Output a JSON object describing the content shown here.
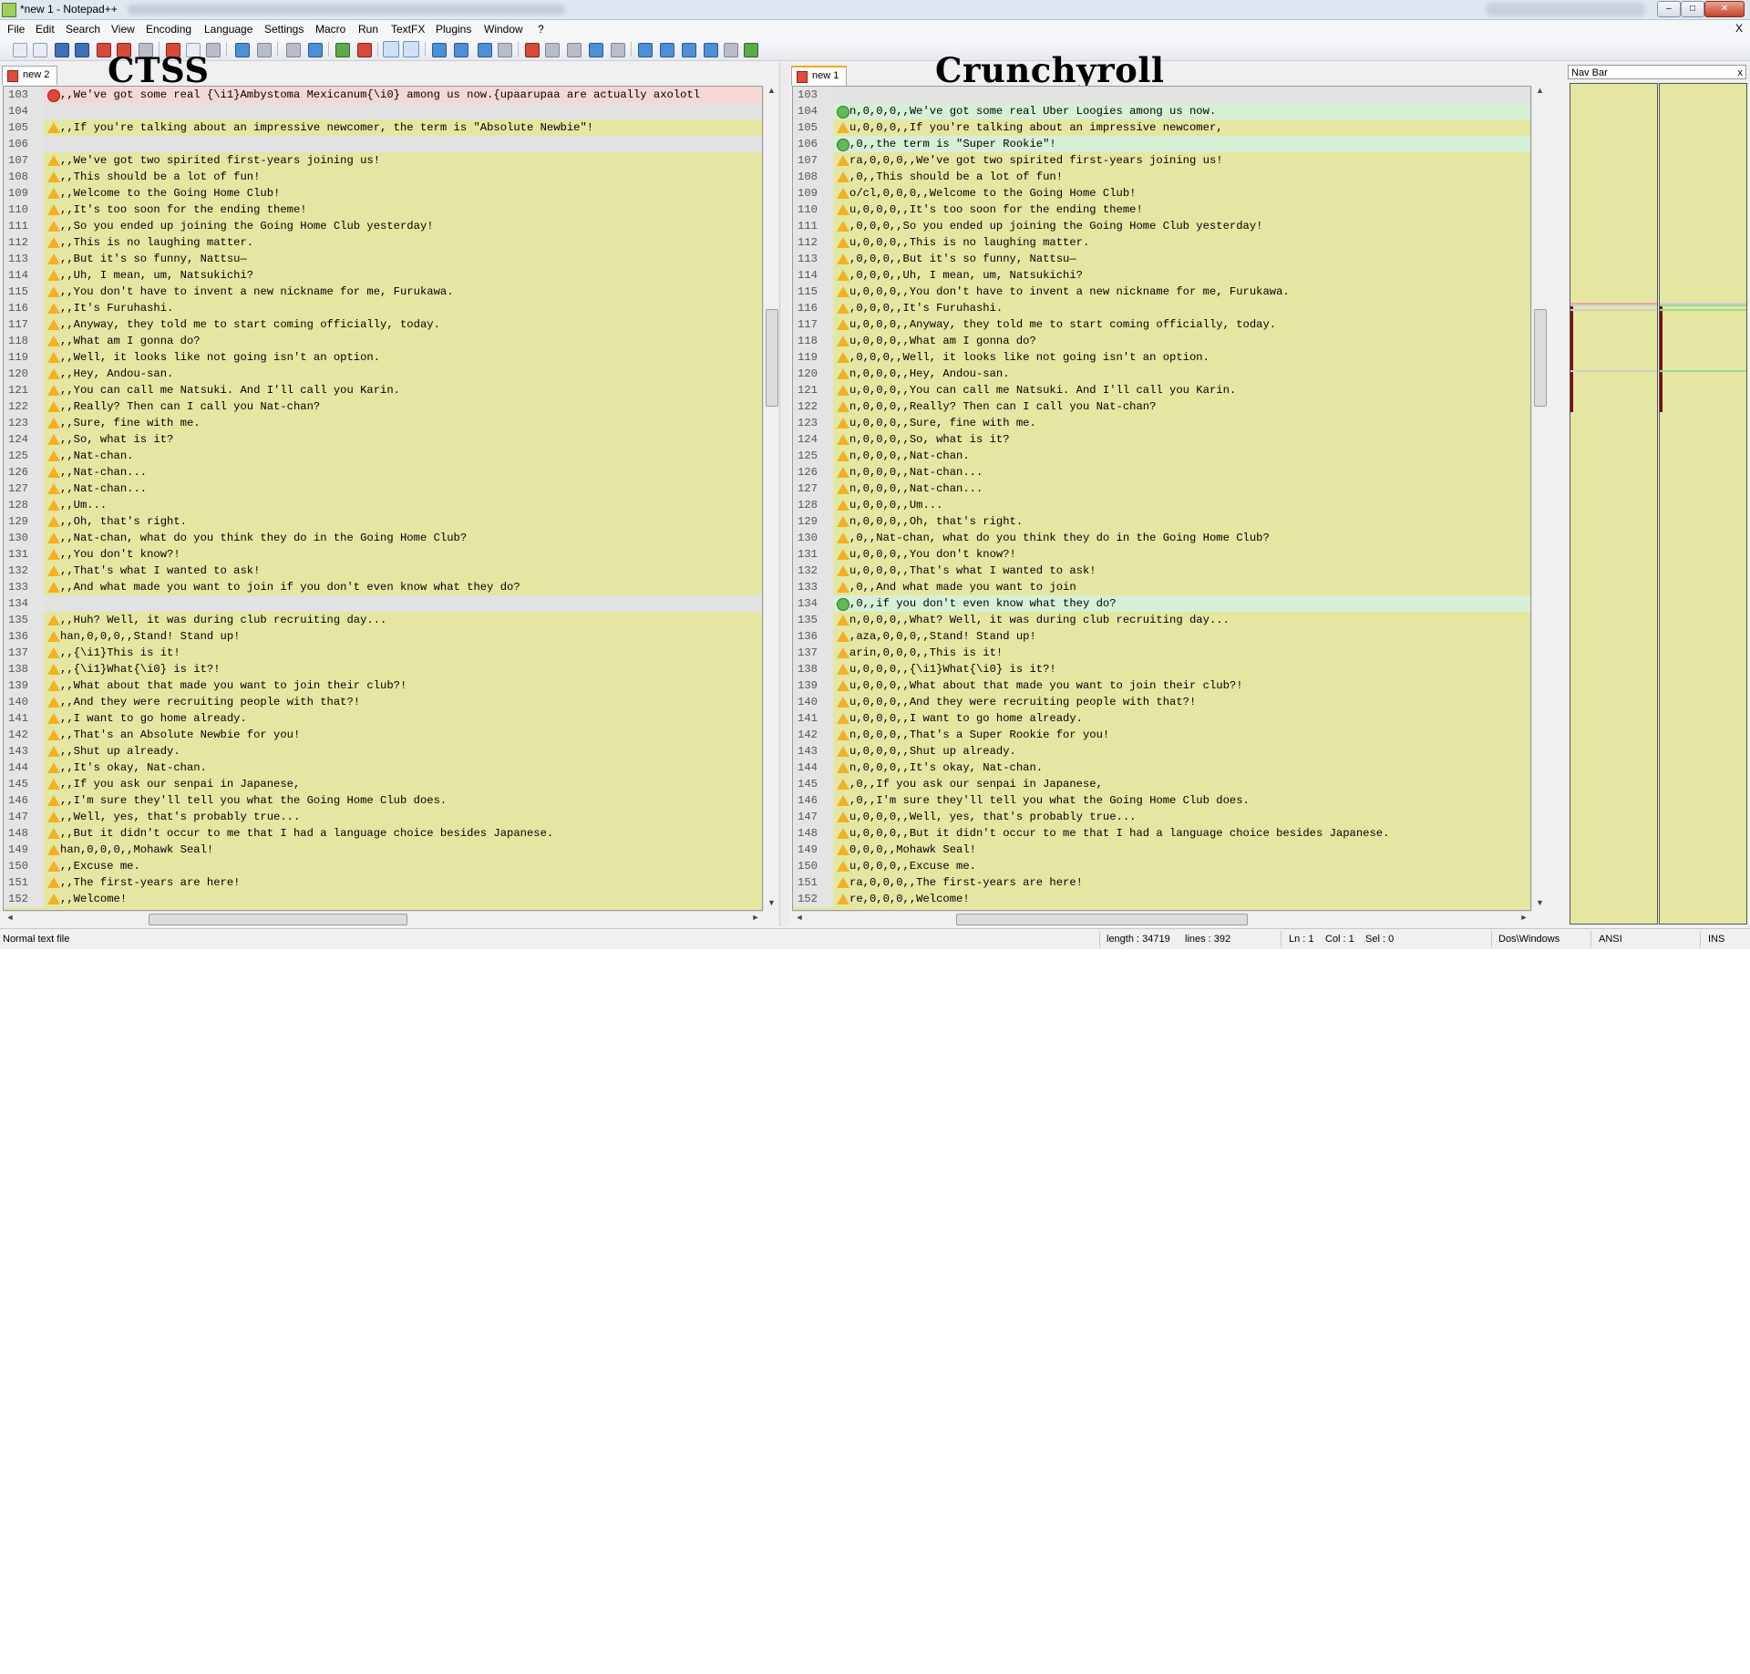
{
  "window": {
    "title": "*new 1 - Notepad++",
    "min_symbol": "–",
    "max_symbol": "□",
    "close_symbol": "✕"
  },
  "menu": [
    "File",
    "Edit",
    "Search",
    "View",
    "Encoding",
    "Language",
    "Settings",
    "Macro",
    "Run",
    "TextFX",
    "Plugins",
    "Window",
    "?"
  ],
  "menu_close": "X",
  "headings": {
    "left": "CTSS",
    "right": "Crunchyroll"
  },
  "tabs": {
    "left": "new 2",
    "right": "new 1"
  },
  "left_lines": [
    {
      "n": "103",
      "t": "removed",
      "m": "err",
      "text": ",,We've got some real {\\i1}Ambystoma Mexicanum{\\i0} among us now.{upaarupaa are actually axolotl"
    },
    {
      "n": "104",
      "t": "empty",
      "m": "",
      "text": ""
    },
    {
      "n": "105",
      "t": "changed",
      "m": "warn",
      "text": ",,If you're talking about an impressive newcomer, the term is \"Absolute Newbie\"!"
    },
    {
      "n": "106",
      "t": "empty",
      "m": "",
      "text": ""
    },
    {
      "n": "107",
      "t": "changed",
      "m": "warn",
      "text": ",,We've got two spirited first-years joining us!"
    },
    {
      "n": "108",
      "t": "changed",
      "m": "warn",
      "text": ",,This should be a lot of fun!"
    },
    {
      "n": "109",
      "t": "changed",
      "m": "warn",
      "text": ",,Welcome to the Going Home Club!"
    },
    {
      "n": "110",
      "t": "changed",
      "m": "warn",
      "text": ",,It's too soon for the ending theme!"
    },
    {
      "n": "111",
      "t": "changed",
      "m": "warn",
      "text": ",,So you ended up joining the Going Home Club yesterday!"
    },
    {
      "n": "112",
      "t": "changed",
      "m": "warn",
      "text": ",,This is no laughing matter."
    },
    {
      "n": "113",
      "t": "changed",
      "m": "warn",
      "text": ",,But it's so funny, Nattsu—"
    },
    {
      "n": "114",
      "t": "changed",
      "m": "warn",
      "text": ",,Uh, I mean, um, Natsukichi?"
    },
    {
      "n": "115",
      "t": "changed",
      "m": "warn",
      "text": ",,You don't have to invent a new nickname for me, Furukawa."
    },
    {
      "n": "116",
      "t": "changed",
      "m": "warn",
      "text": ",,It's Furuhashi."
    },
    {
      "n": "117",
      "t": "changed",
      "m": "warn",
      "text": ",,Anyway, they told me to start coming officially, today."
    },
    {
      "n": "118",
      "t": "changed",
      "m": "warn",
      "text": ",,What am I gonna do?"
    },
    {
      "n": "119",
      "t": "changed",
      "m": "warn",
      "text": ",,Well, it looks like not going isn't an option."
    },
    {
      "n": "120",
      "t": "changed",
      "m": "warn",
      "text": ",,Hey, Andou-san."
    },
    {
      "n": "121",
      "t": "changed",
      "m": "warn",
      "text": ",,You can call me Natsuki. And I'll call you Karin."
    },
    {
      "n": "122",
      "t": "changed",
      "m": "warn",
      "text": ",,Really? Then can I call you Nat-chan?"
    },
    {
      "n": "123",
      "t": "changed",
      "m": "warn",
      "text": ",,Sure, fine with me."
    },
    {
      "n": "124",
      "t": "changed",
      "m": "warn",
      "text": ",,So, what is it?"
    },
    {
      "n": "125",
      "t": "changed",
      "m": "warn",
      "text": ",,Nat-chan."
    },
    {
      "n": "126",
      "t": "changed",
      "m": "warn",
      "text": ",,Nat-chan..."
    },
    {
      "n": "127",
      "t": "changed",
      "m": "warn",
      "text": ",,Nat-chan..."
    },
    {
      "n": "128",
      "t": "changed",
      "m": "warn",
      "text": ",,Um..."
    },
    {
      "n": "129",
      "t": "changed",
      "m": "warn",
      "text": ",,Oh, that's right."
    },
    {
      "n": "130",
      "t": "changed",
      "m": "warn",
      "text": ",,Nat-chan, what do you think they do in the Going Home Club?"
    },
    {
      "n": "131",
      "t": "changed",
      "m": "warn",
      "text": ",,You don't know?!"
    },
    {
      "n": "132",
      "t": "changed",
      "m": "warn",
      "text": ",,That's what I wanted to ask!"
    },
    {
      "n": "133",
      "t": "changed",
      "m": "warn",
      "text": ",,And what made you want to join if you don't even know what they do?"
    },
    {
      "n": "134",
      "t": "empty",
      "m": "",
      "text": ""
    },
    {
      "n": "135",
      "t": "changed",
      "m": "warn",
      "text": ",,Huh? Well, it was during club recruiting day..."
    },
    {
      "n": "136",
      "t": "changed",
      "m": "warn",
      "text": "han,0,0,0,,Stand! Stand up!"
    },
    {
      "n": "137",
      "t": "changed",
      "m": "warn",
      "text": ",,{\\i1}This is it!"
    },
    {
      "n": "138",
      "t": "changed",
      "m": "warn",
      "text": ",,{\\i1}What{\\i0} is it?!"
    },
    {
      "n": "139",
      "t": "changed",
      "m": "warn",
      "text": ",,What about that made you want to join their club?!"
    },
    {
      "n": "140",
      "t": "changed",
      "m": "warn",
      "text": ",,And they were recruiting people with that?!"
    },
    {
      "n": "141",
      "t": "changed",
      "m": "warn",
      "text": ",,I want to go home already."
    },
    {
      "n": "142",
      "t": "changed",
      "m": "warn",
      "text": ",,That's an Absolute Newbie for you!"
    },
    {
      "n": "143",
      "t": "changed",
      "m": "warn",
      "text": ",,Shut up already."
    },
    {
      "n": "144",
      "t": "changed",
      "m": "warn",
      "text": ",,It's okay, Nat-chan."
    },
    {
      "n": "145",
      "t": "changed",
      "m": "warn",
      "text": ",,If you ask our senpai in Japanese,"
    },
    {
      "n": "146",
      "t": "changed",
      "m": "warn",
      "text": ",,I'm sure they'll tell you what the Going Home Club does."
    },
    {
      "n": "147",
      "t": "changed",
      "m": "warn",
      "text": ",,Well, yes, that's probably true..."
    },
    {
      "n": "148",
      "t": "changed",
      "m": "warn",
      "text": ",,But it didn't occur to me that I had a language choice besides Japanese."
    },
    {
      "n": "149",
      "t": "changed",
      "m": "warn",
      "text": "han,0,0,0,,Mohawk Seal!"
    },
    {
      "n": "150",
      "t": "changed",
      "m": "warn",
      "text": ",,Excuse me."
    },
    {
      "n": "151",
      "t": "changed",
      "m": "warn",
      "text": ",,The first-years are here!"
    },
    {
      "n": "152",
      "t": "changed",
      "m": "warn",
      "text": ",,Welcome!"
    }
  ],
  "right_lines": [
    {
      "n": "103",
      "t": "empty",
      "m": "",
      "text": ""
    },
    {
      "n": "104",
      "t": "added",
      "m": "add",
      "text": "n,0,0,0,,We've got some real Uber Loogies among us now."
    },
    {
      "n": "105",
      "t": "changed",
      "m": "warn",
      "text": "u,0,0,0,,If you're talking about an impressive newcomer,"
    },
    {
      "n": "106",
      "t": "added",
      "m": "add",
      "text": ",0,,the term is \"Super Rookie\"!"
    },
    {
      "n": "107",
      "t": "changed",
      "m": "warn",
      "text": "ra,0,0,0,,We've got two spirited first-years joining us!"
    },
    {
      "n": "108",
      "t": "changed",
      "m": "warn",
      "text": ",0,,This should be a lot of fun!"
    },
    {
      "n": "109",
      "t": "changed",
      "m": "warn",
      "text": "o/cl,0,0,0,,Welcome to the Going Home Club!"
    },
    {
      "n": "110",
      "t": "changed",
      "m": "warn",
      "text": "u,0,0,0,,It's too soon for the ending theme!"
    },
    {
      "n": "111",
      "t": "changed",
      "m": "warn",
      "text": ",0,0,0,,So you ended up joining the Going Home Club yesterday!"
    },
    {
      "n": "112",
      "t": "changed",
      "m": "warn",
      "text": "u,0,0,0,,This is no laughing matter."
    },
    {
      "n": "113",
      "t": "changed",
      "m": "warn",
      "text": ",0,0,0,,But it's so funny, Nattsu—"
    },
    {
      "n": "114",
      "t": "changed",
      "m": "warn",
      "text": ",0,0,0,,Uh, I mean, um, Natsukichi?"
    },
    {
      "n": "115",
      "t": "changed",
      "m": "warn",
      "text": "u,0,0,0,,You don't have to invent a new nickname for me, Furukawa."
    },
    {
      "n": "116",
      "t": "changed",
      "m": "warn",
      "text": ",0,0,0,,It's Furuhashi."
    },
    {
      "n": "117",
      "t": "changed",
      "m": "warn",
      "text": "u,0,0,0,,Anyway, they told me to start coming officially, today."
    },
    {
      "n": "118",
      "t": "changed",
      "m": "warn",
      "text": "u,0,0,0,,What am I gonna do?"
    },
    {
      "n": "119",
      "t": "changed",
      "m": "warn",
      "text": ",0,0,0,,Well, it looks like not going isn't an option."
    },
    {
      "n": "120",
      "t": "changed",
      "m": "warn",
      "text": "n,0,0,0,,Hey, Andou-san."
    },
    {
      "n": "121",
      "t": "changed",
      "m": "warn",
      "text": "u,0,0,0,,You can call me Natsuki. And I'll call you Karin."
    },
    {
      "n": "122",
      "t": "changed",
      "m": "warn",
      "text": "n,0,0,0,,Really? Then can I call you Nat-chan?"
    },
    {
      "n": "123",
      "t": "changed",
      "m": "warn",
      "text": "u,0,0,0,,Sure, fine with me."
    },
    {
      "n": "124",
      "t": "changed",
      "m": "warn",
      "text": "n,0,0,0,,So, what is it?"
    },
    {
      "n": "125",
      "t": "changed",
      "m": "warn",
      "text": "n,0,0,0,,Nat-chan."
    },
    {
      "n": "126",
      "t": "changed",
      "m": "warn",
      "text": "n,0,0,0,,Nat-chan..."
    },
    {
      "n": "127",
      "t": "changed",
      "m": "warn",
      "text": "n,0,0,0,,Nat-chan..."
    },
    {
      "n": "128",
      "t": "changed",
      "m": "warn",
      "text": "u,0,0,0,,Um..."
    },
    {
      "n": "129",
      "t": "changed",
      "m": "warn",
      "text": "n,0,0,0,,Oh, that's right."
    },
    {
      "n": "130",
      "t": "changed",
      "m": "warn",
      "text": ",0,,Nat-chan, what do you think they do in the Going Home Club?"
    },
    {
      "n": "131",
      "t": "changed",
      "m": "warn",
      "text": "u,0,0,0,,You don't know?!"
    },
    {
      "n": "132",
      "t": "changed",
      "m": "warn",
      "text": "u,0,0,0,,That's what I wanted to ask!"
    },
    {
      "n": "133",
      "t": "changed",
      "m": "warn",
      "text": ",0,,And what made you want to join"
    },
    {
      "n": "134",
      "t": "added",
      "m": "add",
      "text": ",0,,if you don't even know what they do?"
    },
    {
      "n": "135",
      "t": "changed",
      "m": "warn",
      "text": "n,0,0,0,,What? Well, it was during club recruiting day..."
    },
    {
      "n": "136",
      "t": "changed",
      "m": "warn",
      "text": ",aza,0,0,0,,Stand! Stand up!"
    },
    {
      "n": "137",
      "t": "changed",
      "m": "warn",
      "text": "arin,0,0,0,,This is it!"
    },
    {
      "n": "138",
      "t": "changed",
      "m": "warn",
      "text": "u,0,0,0,,{\\i1}What{\\i0} is it?!"
    },
    {
      "n": "139",
      "t": "changed",
      "m": "warn",
      "text": "u,0,0,0,,What about that made you want to join their club?!"
    },
    {
      "n": "140",
      "t": "changed",
      "m": "warn",
      "text": "u,0,0,0,,And they were recruiting people with that?!"
    },
    {
      "n": "141",
      "t": "changed",
      "m": "warn",
      "text": "u,0,0,0,,I want to go home already."
    },
    {
      "n": "142",
      "t": "changed",
      "m": "warn",
      "text": "n,0,0,0,,That's a Super Rookie for you!"
    },
    {
      "n": "143",
      "t": "changed",
      "m": "warn",
      "text": "u,0,0,0,,Shut up already."
    },
    {
      "n": "144",
      "t": "changed",
      "m": "warn",
      "text": "n,0,0,0,,It's okay, Nat-chan."
    },
    {
      "n": "145",
      "t": "changed",
      "m": "warn",
      "text": ",0,,If you ask our senpai in Japanese,"
    },
    {
      "n": "146",
      "t": "changed",
      "m": "warn",
      "text": ",0,,I'm sure they'll tell you what the Going Home Club does."
    },
    {
      "n": "147",
      "t": "changed",
      "m": "warn",
      "text": "u,0,0,0,,Well, yes, that's probably true..."
    },
    {
      "n": "148",
      "t": "changed",
      "m": "warn",
      "text": "u,0,0,0,,But it didn't occur to me that I had a language choice besides Japanese."
    },
    {
      "n": "149",
      "t": "changed",
      "m": "warn",
      "text": "0,0,0,,Mohawk Seal!"
    },
    {
      "n": "150",
      "t": "changed",
      "m": "warn",
      "text": "u,0,0,0,,Excuse me."
    },
    {
      "n": "151",
      "t": "changed",
      "m": "warn",
      "text": "ra,0,0,0,,The first-years are here!"
    },
    {
      "n": "152",
      "t": "changed",
      "m": "warn",
      "text": "re,0,0,0,,Welcome!"
    }
  ],
  "scroll": {
    "up": "▲",
    "down": "▼",
    "left": "◄",
    "right": "►",
    "grip": "≡",
    "hgrip": "III"
  },
  "navbar": {
    "title": "Nav Bar",
    "close": "x"
  },
  "status": {
    "filetype": "Normal text file",
    "length": "length : 34719",
    "lines": "lines : 392",
    "ln": "Ln : 1",
    "col": "Col : 1",
    "sel": "Sel : 0",
    "eol": "Dos\\Windows",
    "encoding": "ANSI",
    "mode": "INS"
  },
  "colors": {
    "changed": "#e6e6a3",
    "removed": "#f5d8d5",
    "added": "#d6f0d6",
    "empty": "#e2e2e2"
  }
}
